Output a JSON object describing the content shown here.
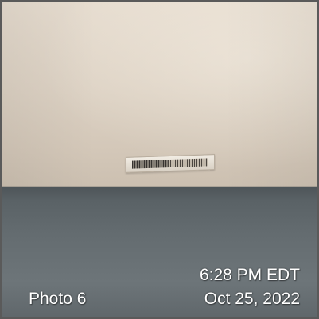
{
  "photo": {
    "label": "Photo 6",
    "time": "6:28 PM EDT",
    "date": "Oct 25, 2022"
  },
  "colors": {
    "ceiling": "#ddd2c4",
    "wall": "#646c70",
    "border": "#5a5a5a",
    "overlay_text": "#ffffff"
  }
}
